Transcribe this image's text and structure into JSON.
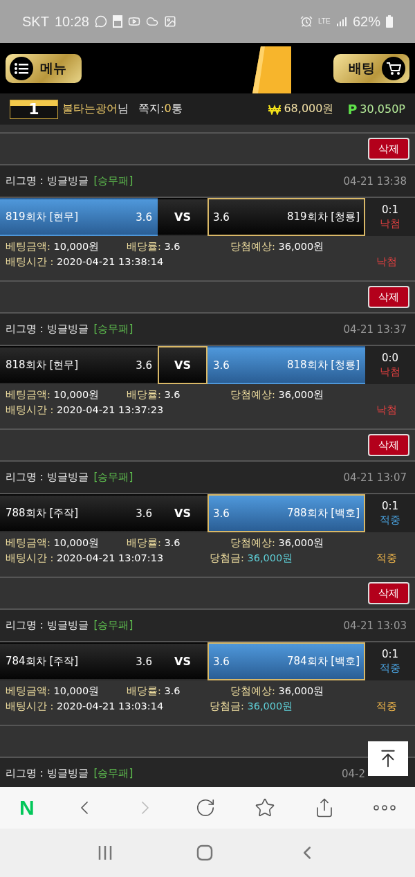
{
  "status_bar": {
    "carrier": "SKT",
    "time": "10:28",
    "network": "LTE",
    "battery": "62%"
  },
  "header": {
    "menu_button": "메뉴",
    "bet_button": "배팅"
  },
  "user": {
    "rank": "1",
    "name": "불타는광어",
    "suffix": "님",
    "messages_label": "쪽지:",
    "messages_count": "0",
    "messages_unit": "통",
    "cash": "68,000원",
    "points_mark": "P",
    "points": "30,050P"
  },
  "bets": [
    {
      "delete": "삭제",
      "league_label": "리그명 : 빙글빙글",
      "bet_type": "[승무패]",
      "date": "04-21 13:38",
      "options": [
        {
          "kind": "home",
          "label": "819회차 [현무]",
          "odds": "3.6",
          "selected": true,
          "winning": false
        },
        {
          "kind": "draw",
          "label": "VS",
          "selected": false,
          "winning": false
        },
        {
          "kind": "away",
          "label": "819회차 [청룡]",
          "odds": "3.6",
          "selected": false,
          "winning": true
        }
      ],
      "score": "0:1",
      "result": "낙첨",
      "kind": "lose",
      "amount_label": "베팅금액:",
      "amount": "10,000원",
      "odds_label": "배당률:",
      "odds": "3.6",
      "expected_label": "당첨예상:",
      "expected": "36,000원",
      "time_label": "배팅시간 :",
      "time": "2020-04-21 13:38:14",
      "final_result": "낙첨"
    },
    {
      "delete": "삭제",
      "league_label": "리그명 : 빙글빙글",
      "bet_type": "[승무패]",
      "date": "04-21 13:37",
      "options": [
        {
          "kind": "home",
          "label": "818회차 [현무]",
          "odds": "3.6",
          "selected": false,
          "winning": false
        },
        {
          "kind": "draw",
          "label": "VS",
          "selected": false,
          "winning": true
        },
        {
          "kind": "away",
          "label": "818회차 [청룡]",
          "odds": "3.6",
          "selected": true,
          "winning": false
        }
      ],
      "score": "0:0",
      "result": "낙첨",
      "kind": "lose",
      "amount_label": "베팅금액:",
      "amount": "10,000원",
      "odds_label": "배당률:",
      "odds": "3.6",
      "expected_label": "당첨예상:",
      "expected": "36,000원",
      "time_label": "배팅시간 :",
      "time": "2020-04-21 13:37:23",
      "final_result": "낙첨"
    },
    {
      "delete": "삭제",
      "league_label": "리그명 : 빙글빙글",
      "bet_type": "[승무패]",
      "date": "04-21 13:07",
      "options": [
        {
          "kind": "home",
          "label": "788회차 [주작]",
          "odds": "3.6",
          "selected": false,
          "winning": false
        },
        {
          "kind": "draw",
          "label": "VS",
          "selected": false,
          "winning": false
        },
        {
          "kind": "away",
          "label": "788회차 [백호]",
          "odds": "3.6",
          "selected": true,
          "winning": true
        }
      ],
      "score": "0:1",
      "result": "적중",
      "kind": "win",
      "amount_label": "베팅금액:",
      "amount": "10,000원",
      "odds_label": "배당률:",
      "odds": "3.6",
      "expected_label": "당첨예상:",
      "expected": "36,000원",
      "time_label": "배팅시간 :",
      "time": "2020-04-21 13:07:13",
      "payout_label": "당첨금:",
      "payout": "36,000원",
      "final_result": "적중"
    },
    {
      "delete": "삭제",
      "league_label": "리그명 : 빙글빙글",
      "bet_type": "[승무패]",
      "date": "04-21 13:03",
      "options": [
        {
          "kind": "home",
          "label": "784회차 [주작]",
          "odds": "3.6",
          "selected": false,
          "winning": false
        },
        {
          "kind": "draw",
          "label": "VS",
          "selected": false,
          "winning": false
        },
        {
          "kind": "away",
          "label": "784회차 [백호]",
          "odds": "3.6",
          "selected": true,
          "winning": true
        }
      ],
      "score": "0:1",
      "result": "적중",
      "kind": "win",
      "amount_label": "베팅금액:",
      "amount": "10,000원",
      "odds_label": "배당률:",
      "odds": "3.6",
      "expected_label": "당첨예상:",
      "expected": "36,000원",
      "time_label": "배팅시간 :",
      "time": "2020-04-21 13:03:14",
      "payout_label": "당첨금:",
      "payout": "36,000원",
      "final_result": "적중"
    }
  ],
  "cut_off_bet": {
    "league_label": "리그명 : 빙글빙글",
    "bet_type": "[승무패]",
    "date": "04-2"
  },
  "browser_bar": {
    "logo": "N"
  }
}
